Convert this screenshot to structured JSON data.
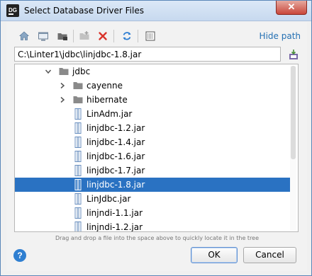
{
  "window": {
    "app_icon_text": "DG",
    "title": "Select Database Driver Files",
    "close_glyph": "✕"
  },
  "toolbar": {
    "buttons": [
      {
        "icon": "home-icon"
      },
      {
        "icon": "desktop-icon"
      },
      {
        "icon": "project-folder-icon"
      },
      {
        "icon": "new-folder-icon"
      },
      {
        "icon": "delete-icon"
      },
      {
        "icon": "refresh-icon"
      },
      {
        "icon": "show-hidden-icon"
      }
    ],
    "hide_path_label": "Hide path"
  },
  "path": {
    "value": "C:\\Linter1\\jdbc\\linjdbc-1.8.jar"
  },
  "tree": {
    "items": [
      {
        "label": "jdbc",
        "type": "folder",
        "expanded": true,
        "selected": false
      },
      {
        "label": "cayenne",
        "type": "folder",
        "expanded": false,
        "selected": false
      },
      {
        "label": "hibernate",
        "type": "folder",
        "expanded": false,
        "selected": false
      },
      {
        "label": "LinAdm.jar",
        "type": "jar",
        "selected": false
      },
      {
        "label": "linjdbc-1.2.jar",
        "type": "jar",
        "selected": false
      },
      {
        "label": "linjdbc-1.4.jar",
        "type": "jar",
        "selected": false
      },
      {
        "label": "linjdbc-1.6.jar",
        "type": "jar",
        "selected": false
      },
      {
        "label": "linjdbc-1.7.jar",
        "type": "jar",
        "selected": false
      },
      {
        "label": "linjdbc-1.8.jar",
        "type": "jar",
        "selected": true
      },
      {
        "label": "LinJdbc.jar",
        "type": "jar",
        "selected": false
      },
      {
        "label": "linjndi-1.1.jar",
        "type": "jar",
        "selected": false
      },
      {
        "label": "linjndi-1.2.jar",
        "type": "jar",
        "selected": false
      }
    ]
  },
  "hint": "Drag and drop a file into the space above to quickly locate it in the tree",
  "help_glyph": "?",
  "buttons": {
    "ok_label": "OK",
    "cancel_label": "Cancel"
  },
  "colors": {
    "selection": "#2a72c2",
    "link": "#2470b3",
    "delete": "#d9342b",
    "folder": "#8a8a8a",
    "jar": "#6a8fbf"
  }
}
